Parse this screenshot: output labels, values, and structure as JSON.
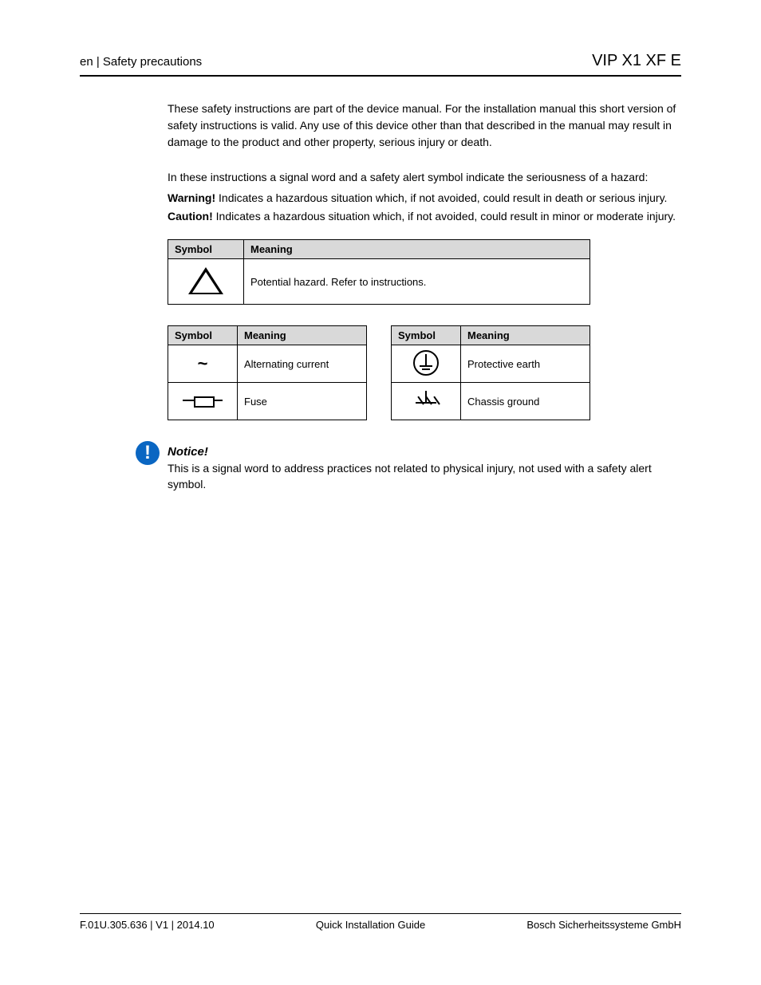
{
  "header": {
    "left": "en | Safety precautions",
    "right": "VIP X1 XF E"
  },
  "intro": "These safety instructions are part of the device manual. For the installation manual this short version of safety instructions is valid. Any use of this device other than that described in the manual may result in damage to the product and other property, serious injury or death.",
  "signal_lead": "In these instructions a signal word and a safety alert symbol indicate the seriousness of a hazard:",
  "signals": {
    "warning_label": "Warning!",
    "warning_desc": "Indicates a hazardous situation which, if not avoided, could result in death or serious injury.",
    "caution_label": "Caution!",
    "caution_desc": "Indicates a hazardous situation which, if not avoided, could result in minor or moderate injury."
  },
  "table_wide": {
    "head_symbol": "Symbol",
    "head_meaning": "Meaning",
    "row_meaning": "Potential hazard. Refer to instructions."
  },
  "table_left": {
    "head_symbol": "Symbol",
    "head_meaning": "Meaning",
    "rows": [
      {
        "symbol": "~",
        "meaning": "Alternating current"
      },
      {
        "symbol": "fuse",
        "meaning": "Fuse"
      }
    ]
  },
  "table_right": {
    "head_symbol": "Symbol",
    "head_meaning": "Meaning",
    "rows": [
      {
        "symbol": "pe",
        "meaning": "Protective earth"
      },
      {
        "symbol": "chg",
        "meaning": "Chassis ground"
      }
    ]
  },
  "notice": {
    "title": "Notice!",
    "body": "This is a signal word to address practices not related to physical injury, not used with a safety alert symbol."
  },
  "footer": {
    "left": "F.01U.305.636 | V1 | 2014.10",
    "center": "Quick Installation Guide",
    "right": "Bosch Sicherheitssysteme GmbH"
  }
}
